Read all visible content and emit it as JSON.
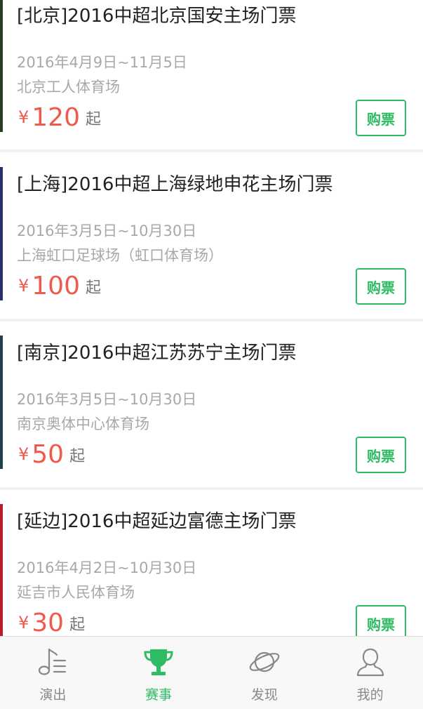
{
  "events": [
    {
      "title": "[北京]2016中超北京国安主场门票",
      "date": "2016年4月9日~11月5日",
      "venue": "北京工人体育场",
      "currency": "¥",
      "price": "120",
      "from_label": "起",
      "buy_label": "购票",
      "thumb_color": "#2a3d22"
    },
    {
      "title": "[上海]2016中超上海绿地申花主场门票",
      "date": "2016年3月5日~10月30日",
      "venue": "上海虹口足球场（虹口体育场）",
      "currency": "¥",
      "price": "100",
      "from_label": "起",
      "buy_label": "购票",
      "thumb_color": "#2b2f6a"
    },
    {
      "title": "[南京]2016中超江苏苏宁主场门票",
      "date": "2016年3月5日~10月30日",
      "venue": "南京奥体中心体育场",
      "currency": "¥",
      "price": "50",
      "from_label": "起",
      "buy_label": "购票",
      "thumb_color": "#1f3f4a"
    },
    {
      "title": "[延边]2016中超延边富德主场门票",
      "date": "2016年4月2日~10月30日",
      "venue": "延吉市人民体育场",
      "currency": "¥",
      "price": "30",
      "from_label": "起",
      "buy_label": "购票",
      "thumb_color": "#b81d2a"
    }
  ],
  "tabbar": {
    "tabs": [
      {
        "label": "演出",
        "icon": "music-note-icon"
      },
      {
        "label": "赛事",
        "icon": "trophy-icon"
      },
      {
        "label": "发现",
        "icon": "planet-icon"
      },
      {
        "label": "我的",
        "icon": "user-icon"
      }
    ],
    "active_index": 1,
    "active_color": "#2dbb63",
    "inactive_color": "#888888"
  }
}
